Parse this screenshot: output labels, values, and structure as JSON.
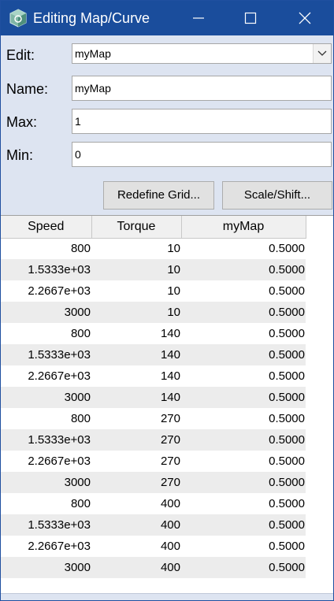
{
  "window": {
    "title": "Editing Map/Curve",
    "app_icon": "map-curve-icon",
    "controls": {
      "minimize": "minimize-icon",
      "maximize": "maximize-icon",
      "close": "close-icon"
    }
  },
  "form": {
    "edit": {
      "label": "Edit:",
      "value": "myMap"
    },
    "name": {
      "label": "Name:",
      "value": "myMap"
    },
    "max": {
      "label": "Max:",
      "value": "1"
    },
    "min": {
      "label": "Min:",
      "value": "0"
    }
  },
  "buttons": {
    "redefine_grid": "Redefine Grid...",
    "scale_shift": "Scale/Shift..."
  },
  "table": {
    "headers": [
      "Speed",
      "Torque",
      "myMap"
    ],
    "rows": [
      [
        "800",
        "10",
        "0.5000"
      ],
      [
        "1.5333e+03",
        "10",
        "0.5000"
      ],
      [
        "2.2667e+03",
        "10",
        "0.5000"
      ],
      [
        "3000",
        "10",
        "0.5000"
      ],
      [
        "800",
        "140",
        "0.5000"
      ],
      [
        "1.5333e+03",
        "140",
        "0.5000"
      ],
      [
        "2.2667e+03",
        "140",
        "0.5000"
      ],
      [
        "3000",
        "140",
        "0.5000"
      ],
      [
        "800",
        "270",
        "0.5000"
      ],
      [
        "1.5333e+03",
        "270",
        "0.5000"
      ],
      [
        "2.2667e+03",
        "270",
        "0.5000"
      ],
      [
        "3000",
        "270",
        "0.5000"
      ],
      [
        "800",
        "400",
        "0.5000"
      ],
      [
        "1.5333e+03",
        "400",
        "0.5000"
      ],
      [
        "2.2667e+03",
        "400",
        "0.5000"
      ],
      [
        "3000",
        "400",
        "0.5000"
      ]
    ]
  },
  "colors": {
    "titlebar": "#1a4d9c",
    "body_background": "#dde4f1",
    "row_stripe": "#ececec"
  }
}
